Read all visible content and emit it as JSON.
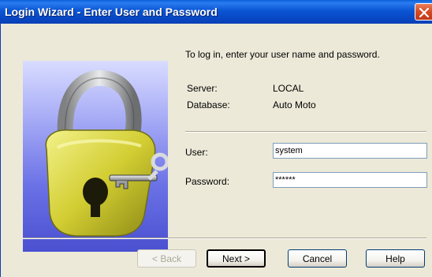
{
  "window": {
    "title": "Login Wizard - Enter User and Password",
    "close_icon": "close-icon"
  },
  "image": {
    "icon": "padlock-key-icon"
  },
  "intro_text": "To log in, enter your user name and password.",
  "info": {
    "server_label": "Server:",
    "server_value": "LOCAL",
    "database_label": "Database:",
    "database_value": "Auto Moto"
  },
  "form": {
    "user_label": "User:",
    "user_value": "system",
    "password_label": "Password:",
    "password_value": "******"
  },
  "buttons": {
    "back": "< Back",
    "next": "Next >",
    "cancel": "Cancel",
    "help": "Help"
  },
  "colors": {
    "titlebar": "#0a55d4",
    "close_button": "#d44a22",
    "dialog_background": "#ece9d8",
    "image_background": "#6b72e6"
  }
}
